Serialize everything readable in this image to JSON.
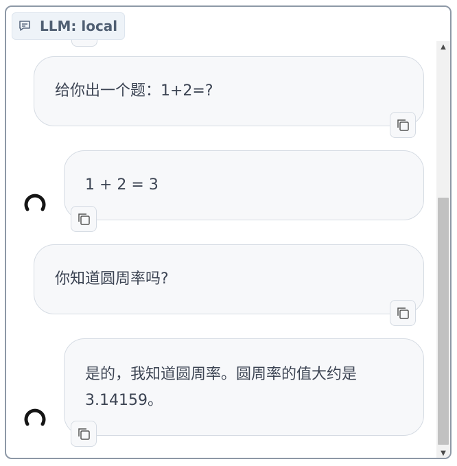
{
  "header": {
    "badge_label": "LLM: local",
    "badge_icon": "chat-icon"
  },
  "messages": [
    {
      "role": "user",
      "text": "给你出一个题：1+2=?"
    },
    {
      "role": "assistant",
      "text": "1 + 2 = 3"
    },
    {
      "role": "user",
      "text": "你知道圆周率吗?"
    },
    {
      "role": "assistant",
      "text": "是的，我知道圆周率。圆周率的值大约是3.14159。"
    }
  ],
  "colors": {
    "panel_border": "#8d98a6",
    "bubble_bg": "#f7f8fa",
    "bubble_border": "#d5dbe3",
    "badge_bg": "#eef3f8",
    "text": "#3c4453"
  }
}
